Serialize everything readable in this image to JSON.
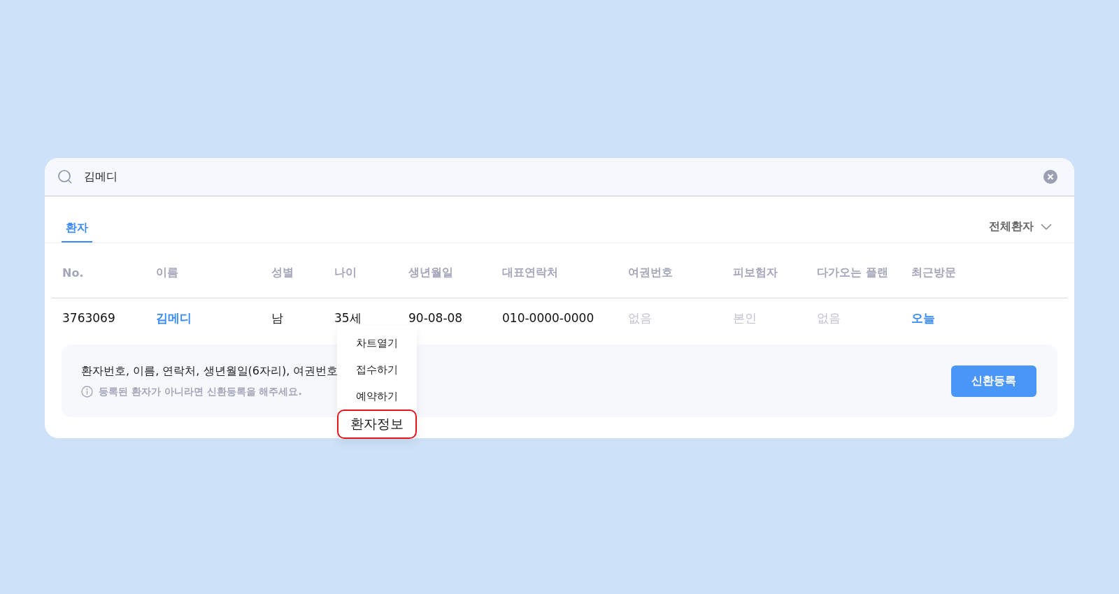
{
  "search": {
    "value": "김메디"
  },
  "tabs": [
    {
      "label": "환자",
      "selected": true
    }
  ],
  "filter": {
    "label": "전체환자"
  },
  "table": {
    "columns": [
      "No.",
      "이름",
      "성별",
      "나이",
      "생년월일",
      "대표연락처",
      "여권번호",
      "피보험자",
      "다가오는 플랜",
      "최근방문"
    ],
    "rows": [
      {
        "cells": [
          {
            "text": "3763069",
            "kind": "plain"
          },
          {
            "text": "김메디",
            "kind": "link"
          },
          {
            "text": "남",
            "kind": "plain"
          },
          {
            "text": "35세",
            "kind": "plain"
          },
          {
            "text": "90-08-08",
            "kind": "plain"
          },
          {
            "text": "010-0000-0000",
            "kind": "plain"
          },
          {
            "text": "없음",
            "kind": "muted"
          },
          {
            "text": "본인",
            "kind": "muted"
          },
          {
            "text": "없음",
            "kind": "muted"
          },
          {
            "text": "오늘",
            "kind": "link"
          }
        ]
      }
    ]
  },
  "context_menu": [
    {
      "label": "차트열기",
      "selected": false
    },
    {
      "label": "접수하기",
      "selected": false
    },
    {
      "label": "예약하기",
      "selected": false
    },
    {
      "label": "환자정보",
      "selected": true
    }
  ],
  "help": {
    "text": "환자번호, 이름, 연락처, 생년월일(6자리), 여권번호",
    "note": "등록된 환자가 아니라면 신환등록을 해주세요."
  },
  "register_button": "신환등록"
}
